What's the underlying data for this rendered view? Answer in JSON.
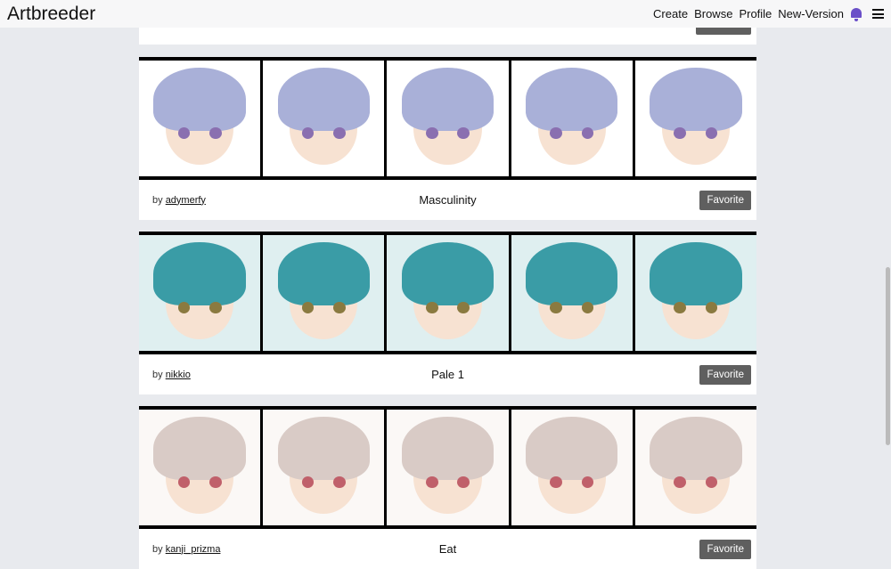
{
  "header": {
    "logo": "Artbreeder",
    "nav": [
      "Create",
      "Browse",
      "Profile",
      "New-Version"
    ]
  },
  "cards": [
    {
      "author": "",
      "title": "",
      "favorite": "Favorite"
    },
    {
      "by": "by",
      "author": "adymerfy",
      "title": "Masculinity",
      "favorite": "Favorite",
      "bg": "#ffffff",
      "hair": "#a9b0d8",
      "eye": "#8a6fb0"
    },
    {
      "by": "by",
      "author": "nikkio",
      "title": "Pale 1",
      "favorite": "Favorite",
      "bg": "#dfeff0",
      "hair": "#3a9ca6",
      "eye": "#8a7a40"
    },
    {
      "by": "by",
      "author": "kanji_prizma",
      "title": "Eat",
      "favorite": "Favorite",
      "bg": "#fbf8f6",
      "hair": "#d9cbc6",
      "eye": "#c0606a"
    }
  ]
}
